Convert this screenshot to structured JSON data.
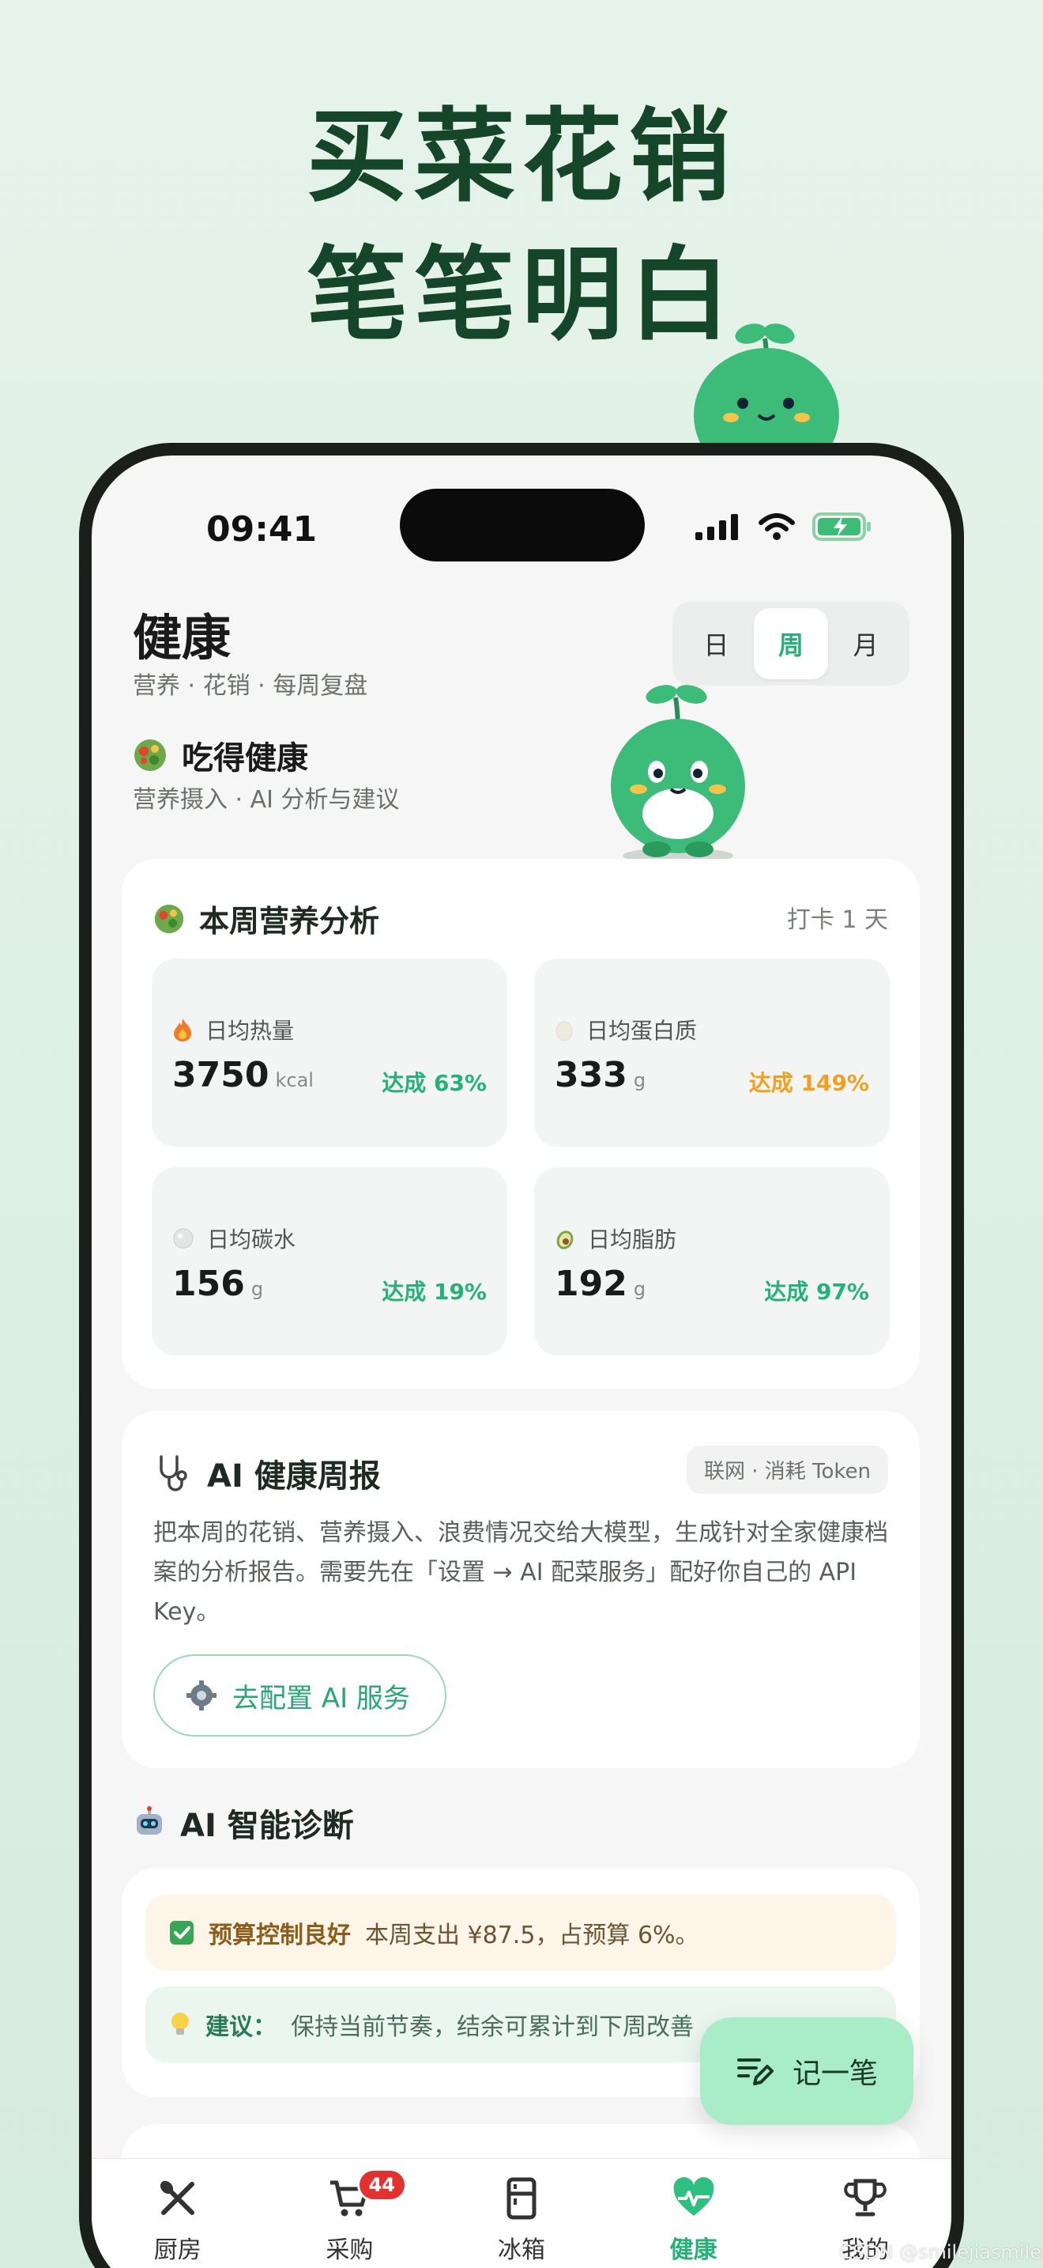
{
  "hero": {
    "line1": "买菜花销",
    "line2": "笔笔明白"
  },
  "status": {
    "time": "09:41"
  },
  "header": {
    "title": "健康",
    "subtitle": "营养 · 花销 · 每周复盘",
    "segments": [
      "日",
      "周",
      "月"
    ],
    "active_segment": "周"
  },
  "section_eat": {
    "title": "吃得健康",
    "subtitle": "营养摄入 · AI 分析与建议"
  },
  "nutrition": {
    "title": "本周营养分析",
    "checkin": "打卡 1 天",
    "stats": [
      {
        "label": "日均热量",
        "value": "3750",
        "unit": "kcal",
        "pct": "达成 63%",
        "color": "#27b07a",
        "icon": "fire-icon"
      },
      {
        "label": "日均蛋白质",
        "value": "333",
        "unit": "g",
        "pct": "达成 149%",
        "color": "#f0a020",
        "icon": "egg-icon"
      },
      {
        "label": "日均碳水",
        "value": "156",
        "unit": "g",
        "pct": "达成 19%",
        "color": "#27b07a",
        "icon": "rice-icon"
      },
      {
        "label": "日均脂肪",
        "value": "192",
        "unit": "g",
        "pct": "达成 97%",
        "color": "#27b07a",
        "icon": "avocado-icon"
      }
    ]
  },
  "ai_report": {
    "title": "AI 健康周报",
    "tag": "联网 · 消耗 Token",
    "desc": "把本周的花销、营养摄入、浪费情况交给大模型，生成针对全家健康档案的分析报告。需要先在「设置 → AI 配菜服务」配好你自己的 API Key。",
    "button": "去配置 AI 服务"
  },
  "diagnosis": {
    "title": "AI 智能诊断",
    "budget_strong": "预算控制良好",
    "budget_text": "本周支出 ¥87.5，占预算 6%。",
    "tip_strong": "建议：",
    "tip_text": "保持当前节奏，结余可累计到下周改善"
  },
  "fab": {
    "label": "记一笔"
  },
  "tabbar": {
    "items": [
      {
        "label": "厨房",
        "icon": "kitchen-icon"
      },
      {
        "label": "采购",
        "icon": "cart-icon"
      },
      {
        "label": "冰箱",
        "icon": "fridge-icon"
      },
      {
        "label": "健康",
        "icon": "heart-pulse-icon"
      },
      {
        "label": "我的",
        "icon": "trophy-icon"
      }
    ],
    "cart_badge": "44",
    "active": "健康"
  },
  "watermark": "CSDN @smilejiasmile"
}
